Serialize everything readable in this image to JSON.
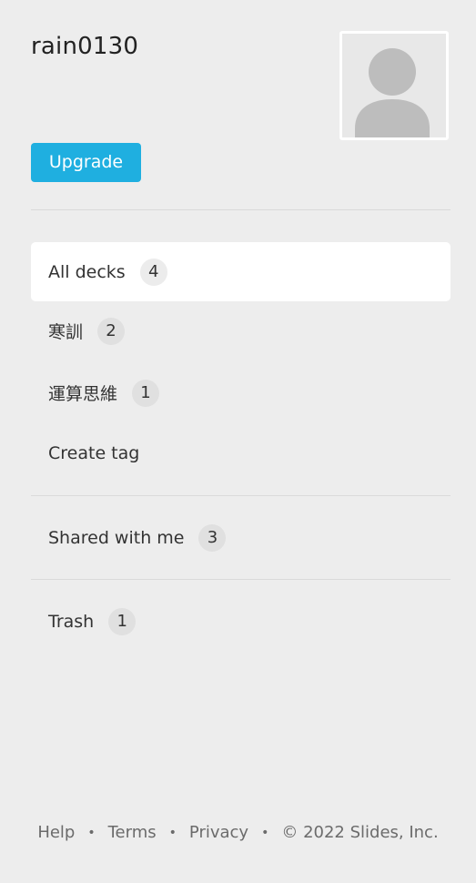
{
  "user": {
    "username": "rain0130",
    "avatar_icon": "default-user-avatar"
  },
  "upgrade_label": "Upgrade",
  "nav": {
    "all_decks": {
      "label": "All decks",
      "count": "4"
    },
    "tags": [
      {
        "label": "寒訓",
        "count": "2"
      },
      {
        "label": "運算思維",
        "count": "1"
      }
    ],
    "create_tag_label": "Create tag",
    "shared": {
      "label": "Shared with me",
      "count": "3"
    },
    "trash": {
      "label": "Trash",
      "count": "1"
    }
  },
  "footer": {
    "help": "Help",
    "terms": "Terms",
    "privacy": "Privacy",
    "copyright": "© 2022 Slides, Inc.",
    "separator": "•"
  },
  "colors": {
    "background": "#ededed",
    "accent": "#1fafe0",
    "active_item": "#ffffff",
    "badge": "#e0e0e0"
  }
}
